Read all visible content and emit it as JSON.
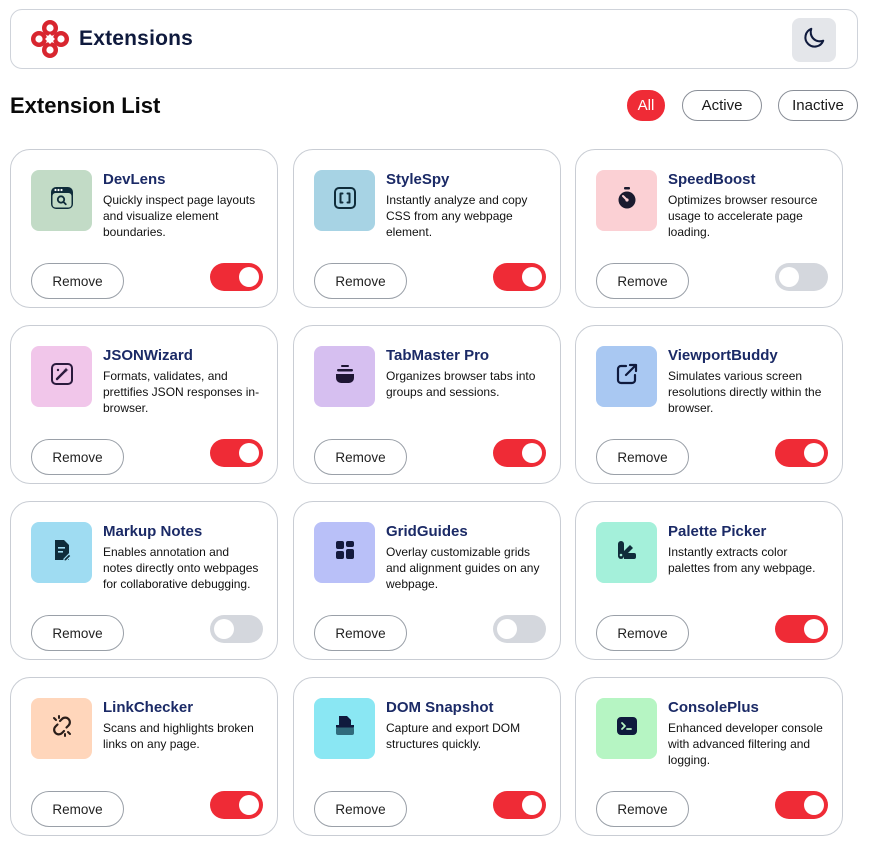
{
  "app": {
    "title": "Extensions"
  },
  "icons": {
    "logo": "logo-icon",
    "theme": "moon-icon"
  },
  "list": {
    "title": "Extension List"
  },
  "filters": [
    {
      "label": "All",
      "active": true
    },
    {
      "label": "Active",
      "active": false
    },
    {
      "label": "Inactive",
      "active": false
    }
  ],
  "colors": {
    "accent": "#ef2b36",
    "toggle_off": "#d4d7dd",
    "name": "#1b2a66",
    "icon_fg": "#0f1a3d"
  },
  "remove_label": "Remove",
  "extensions": [
    {
      "name": "DevLens",
      "description": "Quickly inspect page layouts and visualize element boundaries.",
      "active": true,
      "icon": "browser-search-icon",
      "icon_bg": "#c2dbc6"
    },
    {
      "name": "StyleSpy",
      "description": "Instantly analyze and copy CSS from any webpage element.",
      "active": true,
      "icon": "brackets-icon",
      "icon_bg": "#a7d3e4"
    },
    {
      "name": "SpeedBoost",
      "description": "Optimizes browser resource usage to accelerate page loading.",
      "active": false,
      "icon": "stopwatch-icon",
      "icon_bg": "#fbd0d4"
    },
    {
      "name": "JSONWizard",
      "description": "Formats, validates, and prettifies JSON responses in-browser.",
      "active": true,
      "icon": "magic-file-icon",
      "icon_bg": "#f1c6ea"
    },
    {
      "name": "TabMaster Pro",
      "description": "Organizes browser tabs into groups and sessions.",
      "active": true,
      "icon": "stacked-tabs-icon",
      "icon_bg": "#d6bff0"
    },
    {
      "name": "ViewportBuddy",
      "description": "Simulates various screen resolutions directly within the browser.",
      "active": true,
      "icon": "external-link-icon",
      "icon_bg": "#a9c8f2"
    },
    {
      "name": "Markup Notes",
      "description": "Enables annotation and notes directly onto webpages for collaborative debugging.",
      "active": false,
      "icon": "note-pen-icon",
      "icon_bg": "#9fdcf2"
    },
    {
      "name": "GridGuides",
      "description": "Overlay customizable grids and alignment guides on any webpage.",
      "active": false,
      "icon": "grid-icon",
      "icon_bg": "#b9c0f8"
    },
    {
      "name": "Palette Picker",
      "description": "Instantly extracts color palettes from any webpage.",
      "active": true,
      "icon": "palette-icon",
      "icon_bg": "#a4f0da"
    },
    {
      "name": "LinkChecker",
      "description": "Scans and highlights broken links on any page.",
      "active": true,
      "icon": "broken-link-icon",
      "icon_bg": "#ffd6bb"
    },
    {
      "name": "DOM Snapshot",
      "description": "Capture and export DOM structures quickly.",
      "active": true,
      "icon": "snapshot-icon",
      "icon_bg": "#8ae7f3"
    },
    {
      "name": "ConsolePlus",
      "description": "Enhanced developer console with advanced filtering and logging.",
      "active": true,
      "icon": "terminal-icon",
      "icon_bg": "#b6f5c3"
    }
  ]
}
